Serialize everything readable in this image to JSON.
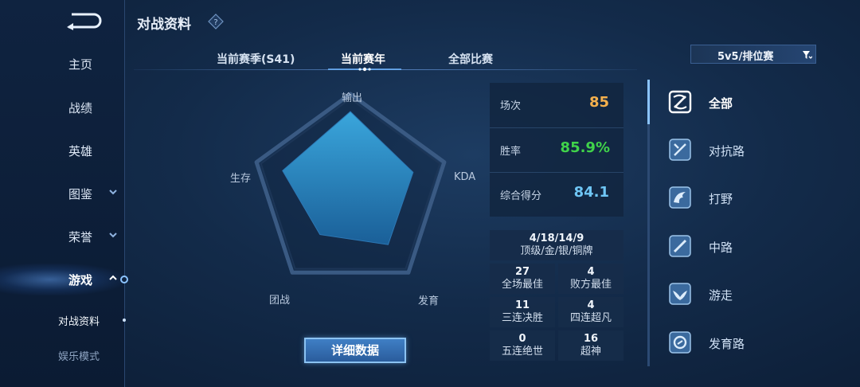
{
  "sidebar": {
    "items": [
      {
        "label": "主页"
      },
      {
        "label": "战绩"
      },
      {
        "label": "英雄"
      },
      {
        "label": "图鉴"
      },
      {
        "label": "荣誉"
      },
      {
        "label": "游戏"
      }
    ],
    "sub_items": [
      {
        "label": "对战资料"
      },
      {
        "label": "娱乐模式"
      }
    ]
  },
  "header": {
    "title": "对战资料"
  },
  "tabs": [
    {
      "label": "当前赛季(S41)"
    },
    {
      "label": "当前赛年",
      "active": true
    },
    {
      "label": "全部比赛"
    }
  ],
  "mode_select": {
    "value": "5v5/排位赛"
  },
  "radar": {
    "axes": [
      "输出",
      "KDA",
      "发育",
      "团战",
      "生存"
    ],
    "values": [
      0.91,
      0.74,
      0.72,
      0.58,
      0.8
    ]
  },
  "detail_button": {
    "label": "详细数据"
  },
  "stats": {
    "games": {
      "label": "场次",
      "value": "85"
    },
    "win_rate": {
      "label": "胜率",
      "value": "85.9%"
    },
    "score": {
      "label": "综合得分",
      "value": "84.1"
    }
  },
  "medals": {
    "value": "4/18/14/9",
    "label": "顶级/金/银/铜牌"
  },
  "achievements": [
    {
      "value": "27",
      "label": "全场最佳"
    },
    {
      "value": "4",
      "label": "败方最佳"
    },
    {
      "value": "11",
      "label": "三连决胜"
    },
    {
      "value": "4",
      "label": "四连超凡"
    },
    {
      "value": "0",
      "label": "五连绝世"
    },
    {
      "value": "16",
      "label": "超神"
    }
  ],
  "roles": [
    {
      "label": "全部",
      "icon": "all-roles-icon",
      "active": true
    },
    {
      "label": "对抗路",
      "icon": "clash-lane-icon"
    },
    {
      "label": "打野",
      "icon": "jungle-icon"
    },
    {
      "label": "中路",
      "icon": "mid-lane-icon"
    },
    {
      "label": "游走",
      "icon": "roam-icon"
    },
    {
      "label": "发育路",
      "icon": "farm-lane-icon"
    }
  ],
  "colors": {
    "games": "#f4b04d",
    "win_rate": "#40d34a",
    "score": "#6fc6f5",
    "accent": "#8bc4ff"
  }
}
